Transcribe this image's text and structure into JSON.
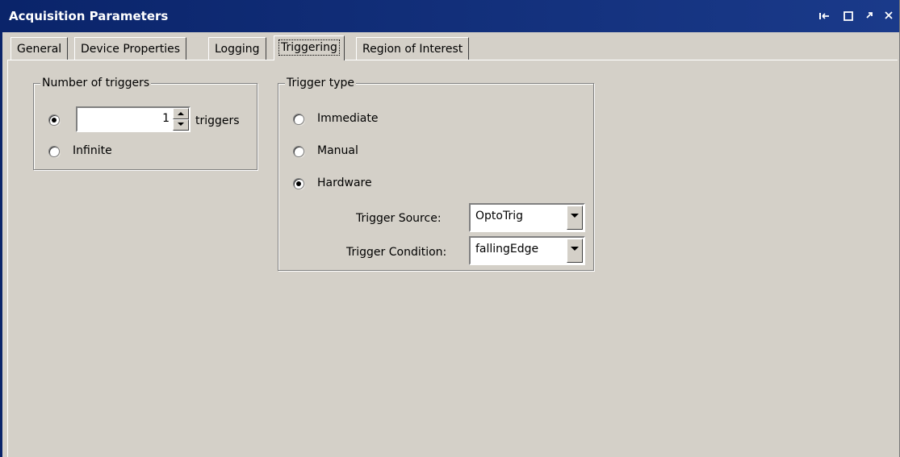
{
  "window": {
    "title": "Acquisition Parameters",
    "controls": [
      "pin-icon",
      "maximize-icon",
      "undock-icon",
      "close-icon"
    ]
  },
  "tabs": [
    {
      "label": "General"
    },
    {
      "label": "Device Properties"
    },
    {
      "label": "Logging"
    },
    {
      "label": "Triggering"
    },
    {
      "label": "Region of Interest"
    }
  ],
  "active_tab": "Triggering",
  "number_of_triggers": {
    "legend": "Number of triggers",
    "count_value": "1",
    "count_unit": "triggers",
    "infinite_label": "Infinite",
    "selected": "count"
  },
  "trigger_type": {
    "legend": "Trigger type",
    "options": {
      "immediate": "Immediate",
      "manual": "Manual",
      "hardware": "Hardware"
    },
    "selected": "hardware",
    "source_label": "Trigger Source:",
    "source_value": "OptoTrig",
    "condition_label": "Trigger Condition:",
    "condition_value": "fallingEdge"
  },
  "colors": {
    "titlebar": "#0a246a",
    "face": "#d4d0c8"
  }
}
